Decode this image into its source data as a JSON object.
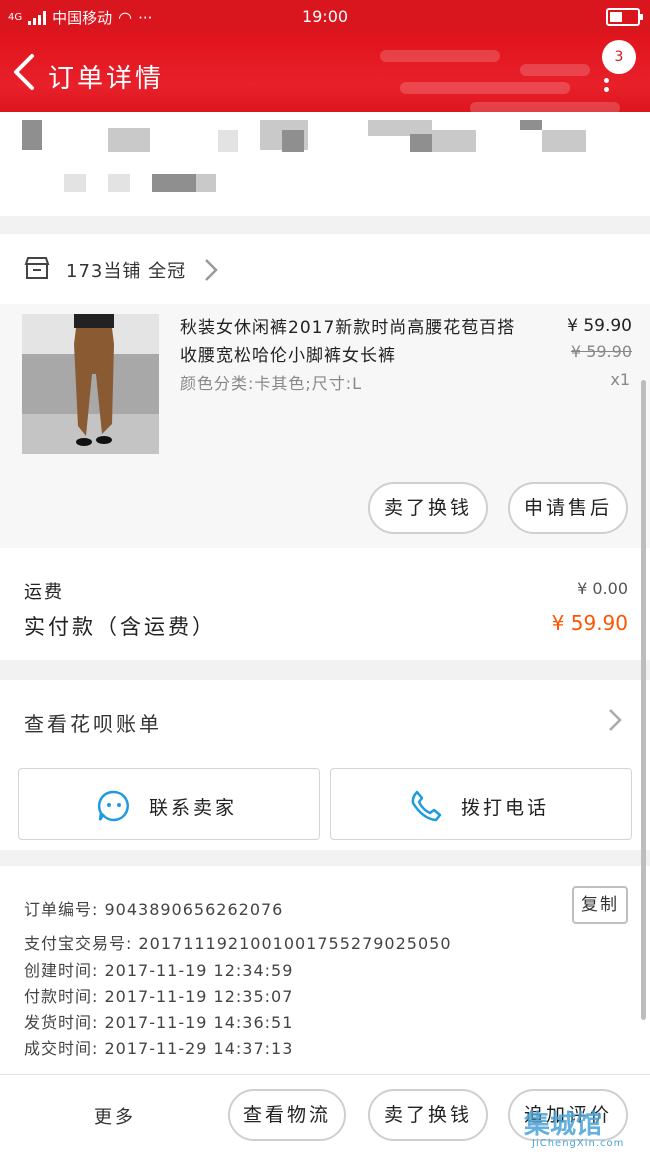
{
  "status_bar": {
    "carrier": "中国移动",
    "network": "4G",
    "more": "···",
    "time": "19:00"
  },
  "header": {
    "title": "订单详情",
    "badge": "3"
  },
  "shop": {
    "name": "173当铺 全冠"
  },
  "product": {
    "title": "秋装女休闲裤2017新款时尚高腰花苞百搭收腰宽松哈伦小脚裤女长裤",
    "spec": "颜色分类:卡其色;尺寸:L",
    "price": "¥ 59.90",
    "original_price": "¥ 59.90",
    "quantity": "x1",
    "buttons": [
      "卖了换钱",
      "申请售后"
    ]
  },
  "totals": {
    "shipping_label": "运费",
    "shipping_value": "¥ 0.00",
    "paid_label": "实付款（含运费）",
    "paid_value": "¥ 59.90",
    "accent_color": "#ff5500"
  },
  "huabei": {
    "label": "查看花呗账单",
    "contact_seller": "联系卖家",
    "call": "拨打电话"
  },
  "order_info": {
    "order_no": "订单编号: 9043890656262076",
    "alipay_no": "支付宝交易号: 2017111921001001755279025050",
    "created": "创建时间: 2017-11-19 12:34:59",
    "paid": "付款时间: 2017-11-19 12:35:07",
    "shipped": "发货时间: 2017-11-19 14:36:51",
    "completed": "成交时间: 2017-11-29 14:37:13",
    "copy_label": "复制"
  },
  "bottom_bar": {
    "more": "更多",
    "logistics": "查看物流",
    "sell": "卖了换钱",
    "review": "追加评价"
  },
  "watermark": {
    "logo": "集城馆",
    "url": "JiChengXin.com"
  },
  "colors": {
    "brand_red": "#d9161d",
    "icon_blue": "#1e9be0"
  }
}
